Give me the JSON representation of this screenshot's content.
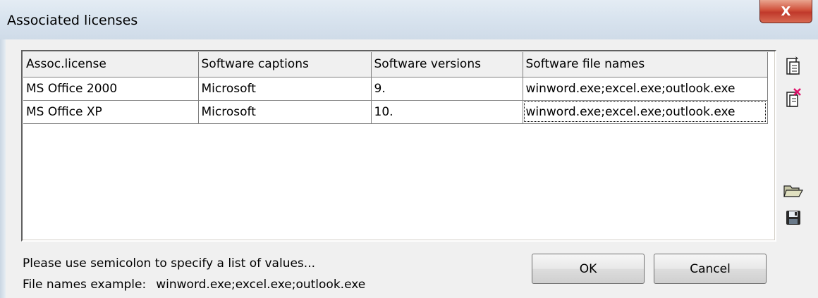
{
  "window": {
    "title": "Associated licenses",
    "close_glyph": "X"
  },
  "grid": {
    "columns": [
      "Assoc.license",
      "Software captions",
      "Software versions",
      "Software file names"
    ],
    "rows": [
      [
        "MS Office 2000",
        "Microsoft",
        "9.",
        "winword.exe;excel.exe;outlook.exe"
      ],
      [
        "MS Office XP",
        "Microsoft",
        "10.",
        "winword.exe;excel.exe;outlook.exe"
      ]
    ]
  },
  "tools": {
    "icons": [
      "add-row-icon",
      "delete-row-icon",
      "open-folder-icon",
      "save-disk-icon"
    ]
  },
  "hints": {
    "line1": "Please use semicolon to specify a list of values...",
    "line2_label": "File names example:",
    "line2_example": "winword.exe;excel.exe;outlook.exe"
  },
  "buttons": {
    "ok": "OK",
    "cancel": "Cancel"
  },
  "colors": {
    "close_button": "#c0392b",
    "window_background": "#f0f0f0",
    "title_bar": "#d9e4ef"
  }
}
